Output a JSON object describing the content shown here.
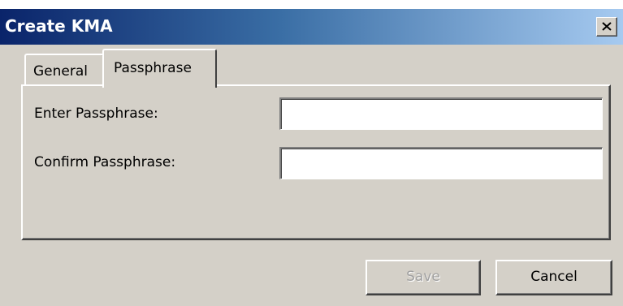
{
  "window": {
    "title": "Create KMA"
  },
  "tabs": [
    {
      "label": "General",
      "selected": false
    },
    {
      "label": "Passphrase",
      "selected": true
    }
  ],
  "form": {
    "enter_label": "Enter Passphrase:",
    "enter_value": "",
    "confirm_label": "Confirm Passphrase:",
    "confirm_value": ""
  },
  "buttons": {
    "save_label": "Save",
    "save_enabled": false,
    "cancel_label": "Cancel"
  },
  "icons": {
    "close": "close-icon"
  },
  "colors": {
    "title_gradient_start": "#0a246a",
    "title_gradient_end": "#a6caf0",
    "face": "#d4d0c8"
  }
}
